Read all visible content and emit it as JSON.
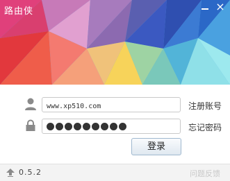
{
  "window": {
    "title": "路由侠",
    "minimize_icon": "minimize-icon",
    "close_symbol": "×"
  },
  "login": {
    "username_value": "www.xp510.com",
    "password_mask": "●●●●●●●●●",
    "register_link": "注册账号",
    "forgot_link": "忘记密码",
    "login_button": "登录",
    "user_icon": "user-icon",
    "lock_icon": "lock-icon"
  },
  "footer": {
    "version": "0.5.2",
    "feedback": "问题反馈",
    "update_icon": "upload-arrow-icon"
  },
  "colors": {
    "button_border": "#9fb8cf",
    "field_border": "#c9c9c9"
  }
}
